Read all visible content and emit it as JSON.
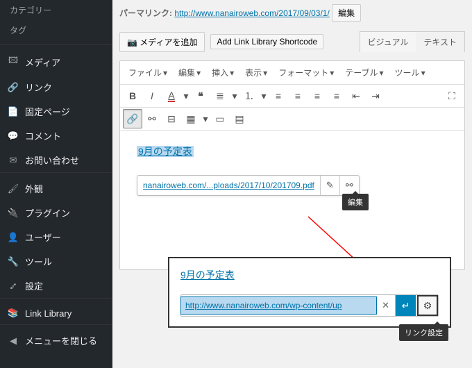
{
  "sidebar": {
    "subs": [
      "カテゴリー",
      "タグ"
    ],
    "items": [
      {
        "icon": "🖾",
        "label": "メディア"
      },
      {
        "icon": "🔗",
        "label": "リンク"
      },
      {
        "icon": "📄",
        "label": "固定ページ"
      },
      {
        "icon": "💬",
        "label": "コメント"
      },
      {
        "icon": "✉",
        "label": "お問い合わせ"
      }
    ],
    "items2": [
      {
        "icon": "🖌",
        "label": "外観"
      },
      {
        "icon": "🔌",
        "label": "プラグイン"
      },
      {
        "icon": "👤",
        "label": "ユーザー"
      },
      {
        "icon": "🔧",
        "label": "ツール"
      },
      {
        "icon": "⑇",
        "label": "設定"
      }
    ],
    "items3": [
      {
        "icon": "📚",
        "label": "Link Library"
      }
    ],
    "collapse": {
      "icon": "◀",
      "label": "メニューを閉じる"
    }
  },
  "permalink": {
    "label": "パーマリンク:",
    "url": "http://www.nanairoweb.com/2017/09/03/1/",
    "edit": "編集"
  },
  "buttons": {
    "add_media": "メディアを追加",
    "shortcode": "Add Link Library Shortcode"
  },
  "tabs": {
    "visual": "ビジュアル",
    "text": "テキスト"
  },
  "menubar": [
    "ファイル",
    "編集",
    "挿入",
    "表示",
    "フォーマット",
    "テーブル",
    "ツール"
  ],
  "content": {
    "title_link": "9月の予定表",
    "link_url_display": "nanairoweb.com/...ploads/2017/10/201709.pdf",
    "edit_tooltip": "編集"
  },
  "inset": {
    "title_link": "9月の予定表",
    "url_value": "http://www.nanairoweb.com/wp-content/up",
    "gear_tooltip": "リンク設定"
  }
}
